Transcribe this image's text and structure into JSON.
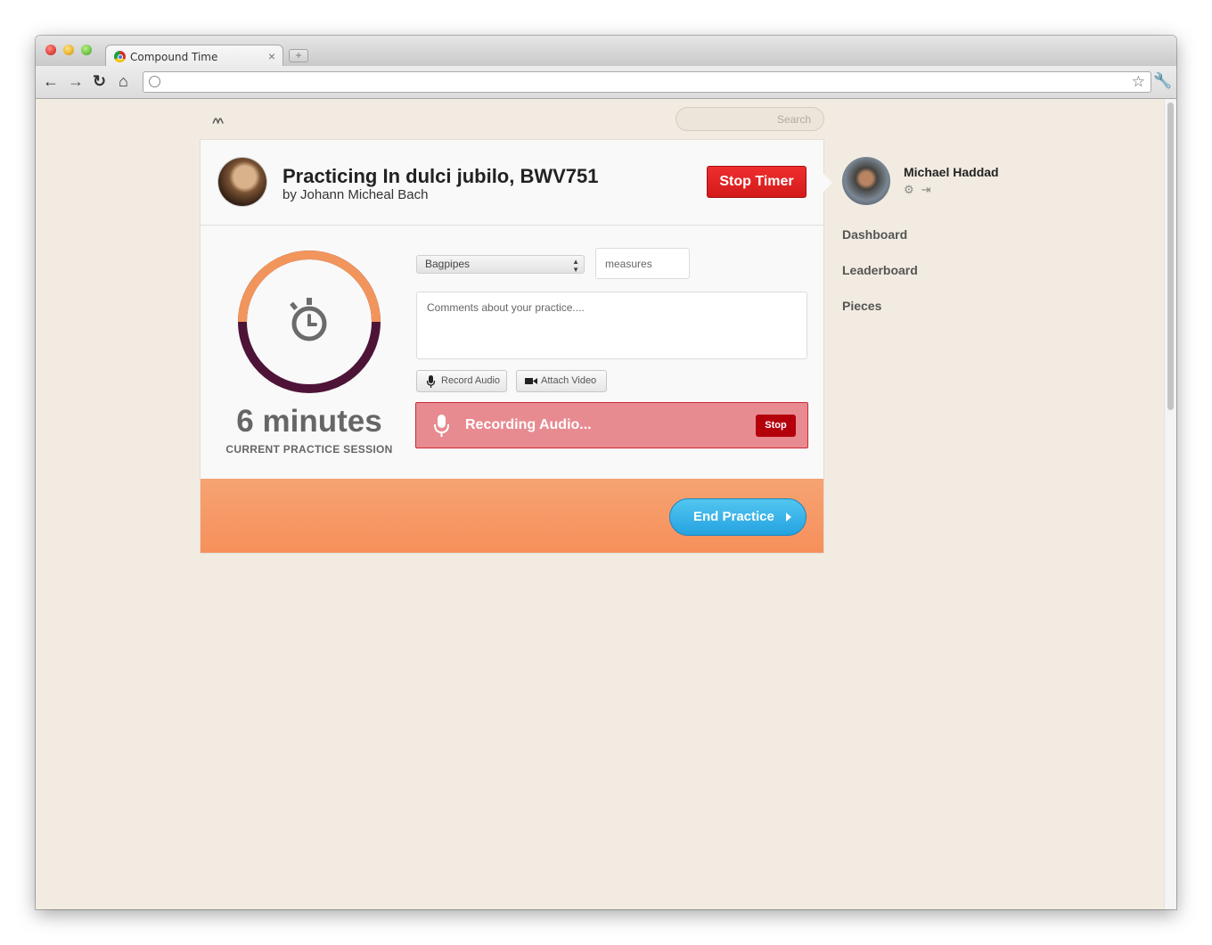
{
  "browser": {
    "tab_title": "Compound Time",
    "tab_close": "×",
    "new_tab": "+",
    "url": ""
  },
  "page": {
    "logo": "^^",
    "search_placeholder": "Search"
  },
  "practice": {
    "title": "Practicing In dulci jubilo, BWV751",
    "subtitle": "by Johann Micheal Bach",
    "stop_timer_label": "Stop Timer",
    "timer_progress": 0.5,
    "minutes_text": "6 minutes",
    "session_label": "CURRENT PRACTICE SESSION",
    "instrument_selected": "Bagpipes",
    "measures_placeholder": "measures",
    "comments_placeholder": "Comments about your practice....",
    "record_audio_label": "Record Audio",
    "attach_video_label": "Attach Video",
    "recording_label": "Recording Audio...",
    "recording_stop_label": "Stop",
    "end_practice_label": "End Practice"
  },
  "user": {
    "name": "Michael Haddad"
  },
  "sidebar": {
    "items": [
      {
        "label": "Dashboard"
      },
      {
        "label": "Leaderboard"
      },
      {
        "label": "Pieces"
      }
    ]
  },
  "colors": {
    "page_bg": "#f2ebe1",
    "ring_elapsed": "#f2955c",
    "ring_remaining": "#4e1437",
    "stop_red": "#e02424",
    "recording_bg": "#e78b91",
    "footer_orange": "#f6905b",
    "end_practice_blue": "#2fb0e8"
  }
}
